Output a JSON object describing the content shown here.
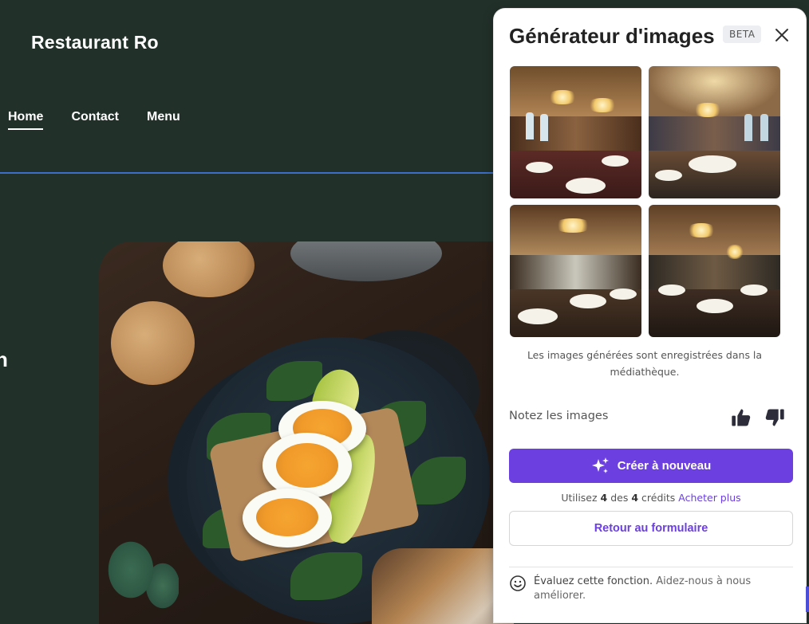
{
  "site": {
    "title": "Restaurant Ro",
    "nav": [
      "Home",
      "Contact",
      "Menu"
    ],
    "hero_fragment": "n"
  },
  "panel": {
    "title": "Générateur d'images",
    "badge": "BETA",
    "caption": "Les images générées sont enregistrées dans la médiathèque.",
    "rate_label": "Notez les images",
    "create_button": "Créer à nouveau",
    "credits": {
      "prefix": "Utilisez",
      "used": "4",
      "middle": "des",
      "total": "4",
      "suffix": "crédits",
      "buy_link": "Acheter plus"
    },
    "back_button": "Retour au formulaire",
    "feedback": {
      "primary": "Évaluez cette fonction.",
      "secondary": "Aidez-nous à nous améliorer."
    }
  },
  "icons": {
    "close": "close-icon",
    "thumbs_up": "thumbs-up-icon",
    "thumbs_down": "thumbs-down-icon",
    "sparkle": "sparkle-icon",
    "smile": "smile-icon"
  },
  "colors": {
    "site_bg": "#22302a",
    "accent": "#6b3fe0",
    "header_line": "#3b6ec9"
  }
}
